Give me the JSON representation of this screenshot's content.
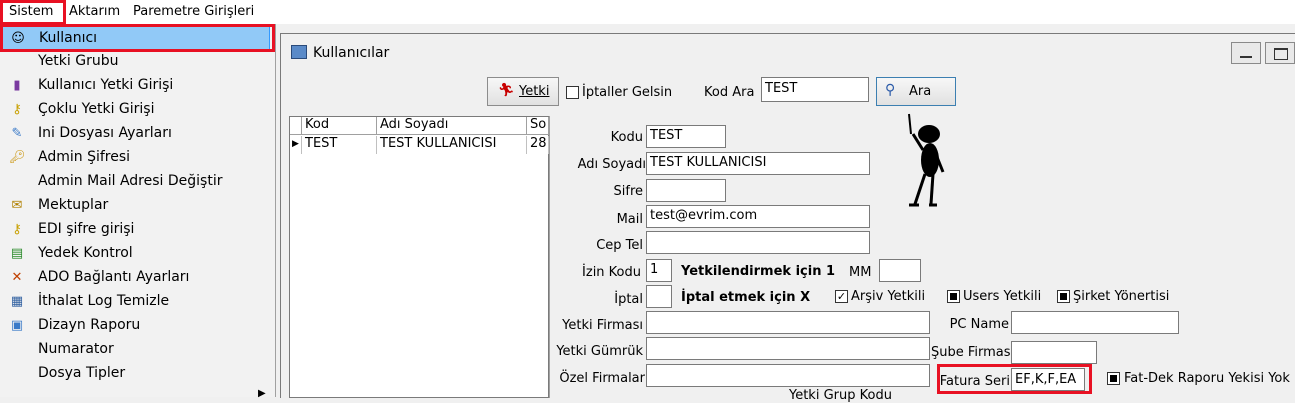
{
  "menubar": {
    "items": [
      {
        "label": "Sistem"
      },
      {
        "label": "Aktarım"
      },
      {
        "label": "Paremetre Girişleri"
      }
    ]
  },
  "sistem_menu": {
    "items": [
      {
        "label": "Kullanıcı",
        "icon": "user-icon"
      },
      {
        "label": "Yetki Grubu",
        "icon": ""
      },
      {
        "label": "Kullanıcı Yetki Girişi",
        "icon": "bottle-icon"
      },
      {
        "label": "Çoklu Yetki Girişi",
        "icon": "keys-icon"
      },
      {
        "label": "Ini Dosyası  Ayarları",
        "icon": "settings-file-icon"
      },
      {
        "label": "Admin Şifresi",
        "icon": "key-icon"
      },
      {
        "label": "Admin Mail Adresi Değiştir",
        "icon": ""
      },
      {
        "label": "Mektuplar",
        "icon": "mail-icon"
      },
      {
        "label": "EDI şifre girişi",
        "icon": "keys-icon"
      },
      {
        "label": "Yedek Kontrol",
        "icon": "backup-icon"
      },
      {
        "label": "ADO Bağlantı Ayarları",
        "icon": "connection-icon"
      },
      {
        "label": "İthalat Log Temizle",
        "icon": "log-icon"
      },
      {
        "label": "Dizayn Raporu",
        "icon": "report-icon"
      },
      {
        "label": "Numarator",
        "icon": ""
      },
      {
        "label": "Dosya Tipler",
        "icon": ""
      }
    ]
  },
  "window": {
    "title": "Kullanıcılar"
  },
  "toolbar": {
    "yetki_label": "Yetki",
    "iptaller_label": "İptaller Gelsin",
    "kod_ara_label": "Kod Ara",
    "kod_ara_value": "TEST",
    "ara_label": "Ara"
  },
  "grid": {
    "columns": [
      "Kod",
      "Adı Soyadı",
      "So"
    ],
    "rows": [
      {
        "kod": "TEST",
        "adi": "TEST KULLANICISI",
        "so": "28"
      }
    ]
  },
  "form": {
    "kodu_label": "Kodu",
    "kodu_value": "TEST",
    "adi_label": "Adı Soyadı",
    "adi_value": "TEST KULLANICISI",
    "sifre_label": "Sifre",
    "sifre_value": "",
    "mail_label": "Mail",
    "mail_value": "test@evrim.com",
    "ceptel_label": "Cep Tel",
    "ceptel_value": "",
    "izin_label": "İzin Kodu",
    "izin_value": "1",
    "izin_hint": "Yetkilendirmek için 1",
    "mm_label": "MM",
    "mm_value": "",
    "iptal_label": "İptal",
    "iptal_value": "",
    "iptal_hint": "İptal etmek için X",
    "arsiv_label": "Arşiv Yetkili",
    "users_label": "Users Yetkili",
    "sirket_label": "Şirket Yönertisi",
    "yetki_firmasi_label": "Yetki Firması",
    "yetki_firmasi_value": "",
    "pcname_label": "PC Name",
    "pcname_value": "",
    "yetki_gumruk_label": "Yetki Gümrük",
    "yetki_gumruk_value": "",
    "sube_label": "Şube Firmas",
    "sube_value": "",
    "ozel_label": "Özel Firmalar",
    "ozel_value": "",
    "fatura_label": "Fatura Seri",
    "fatura_value": "EF,K,F,EA",
    "fatdek_label": "Fat-Dek Raporu Yekisi Yok",
    "grup_label": "Yetki Grup Kodu"
  },
  "colors": {
    "highlight": "#91c9f7",
    "annotation": "#e81123"
  }
}
